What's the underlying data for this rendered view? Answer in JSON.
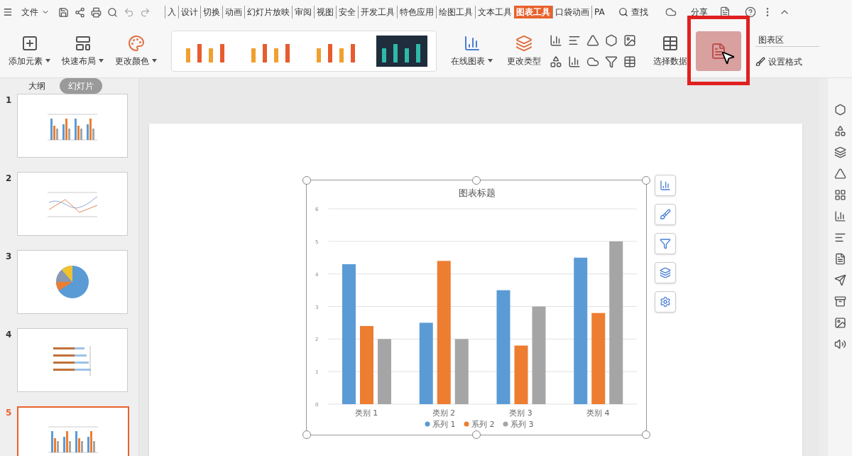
{
  "menu": {
    "label": "文件"
  },
  "tabs": [
    {
      "label": "入",
      "selected": false
    },
    {
      "label": "设计",
      "selected": false
    },
    {
      "label": "切换",
      "selected": false
    },
    {
      "label": "动画",
      "selected": false
    },
    {
      "label": "幻灯片放映",
      "selected": false
    },
    {
      "label": "审阅",
      "selected": false
    },
    {
      "label": "视图",
      "selected": false
    },
    {
      "label": "安全",
      "selected": false
    },
    {
      "label": "开发工具",
      "selected": false
    },
    {
      "label": "特色应用",
      "selected": false
    },
    {
      "label": "绘图工具",
      "selected": false
    },
    {
      "label": "文本工具",
      "selected": false
    },
    {
      "label": "图表工具",
      "selected": true
    },
    {
      "label": "口袋动画",
      "selected": false
    },
    {
      "label": "PA",
      "selected": false
    }
  ],
  "search": {
    "label": "查找"
  },
  "share": {
    "label": "分享"
  },
  "ribbon": {
    "left_buttons": [
      {
        "label": "添加元素"
      },
      {
        "label": "快速布局"
      },
      {
        "label": "更改颜色"
      }
    ],
    "style_gallery": [
      {
        "dark": false
      },
      {
        "dark": false
      },
      {
        "dark": false
      },
      {
        "dark": true
      }
    ],
    "chart_buttons": [
      {
        "label": "在线图表"
      },
      {
        "label": "更改类型"
      }
    ],
    "select_data": {
      "label": "选择数据"
    },
    "highlighted_button": {
      "selected": true
    },
    "chart_area": {
      "value": "图表区"
    },
    "format": {
      "label": "设置格式"
    }
  },
  "panel_tabs": [
    {
      "label": "大纲",
      "selected": false
    },
    {
      "label": "幻灯片",
      "selected": true
    }
  ],
  "slides": [
    {
      "number": "1",
      "kind": "bar",
      "selected": false
    },
    {
      "number": "2",
      "kind": "line",
      "selected": false
    },
    {
      "number": "3",
      "kind": "pie",
      "selected": false
    },
    {
      "number": "4",
      "kind": "hbar",
      "selected": false
    },
    {
      "number": "5",
      "kind": "bar",
      "selected": true
    }
  ],
  "chart": {
    "chart_data": {
      "type": "bar",
      "title": "图表标题",
      "categories": [
        "类别 1",
        "类别 2",
        "类别 3",
        "类别 4"
      ],
      "series": [
        {
          "name": "系列 1",
          "color": "#5b9bd5",
          "values": [
            4.3,
            2.5,
            3.5,
            4.5
          ]
        },
        {
          "name": "系列 2",
          "color": "#ed7d31",
          "values": [
            2.4,
            4.4,
            1.8,
            2.8
          ]
        },
        {
          "name": "系列 3",
          "color": "#a5a5a5",
          "values": [
            2,
            2,
            3,
            5
          ]
        }
      ],
      "ylim": [
        0,
        6
      ],
      "yticks": [
        0,
        1,
        2,
        3,
        4,
        5,
        6
      ],
      "grid": true,
      "legend": true
    }
  }
}
